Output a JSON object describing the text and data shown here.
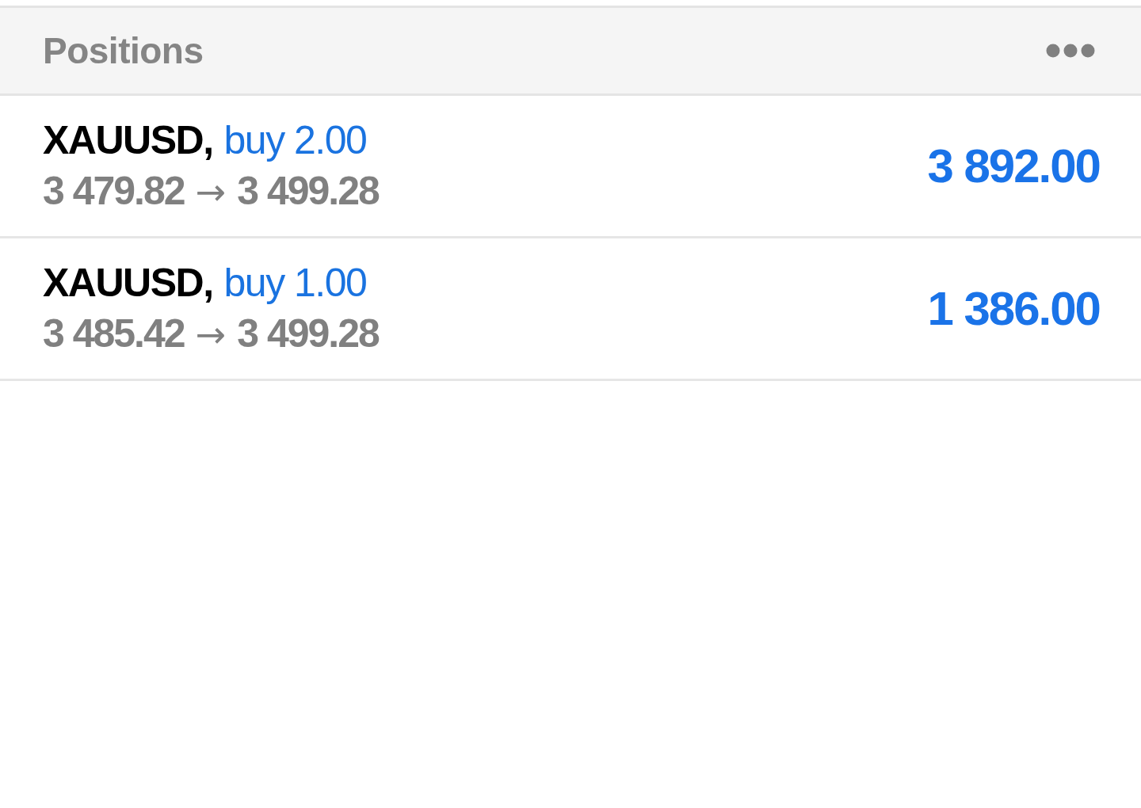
{
  "header": {
    "title": "Positions"
  },
  "positions": [
    {
      "symbol": "XAUUSD,",
      "side": "buy 2.00",
      "open_price": "3 479.82",
      "arrow": "→",
      "current_price": "3 499.28",
      "profit": "3 892.00"
    },
    {
      "symbol": "XAUUSD,",
      "side": "buy 1.00",
      "open_price": "3 485.42",
      "arrow": "→",
      "current_price": "3 499.28",
      "profit": "1 386.00"
    }
  ]
}
